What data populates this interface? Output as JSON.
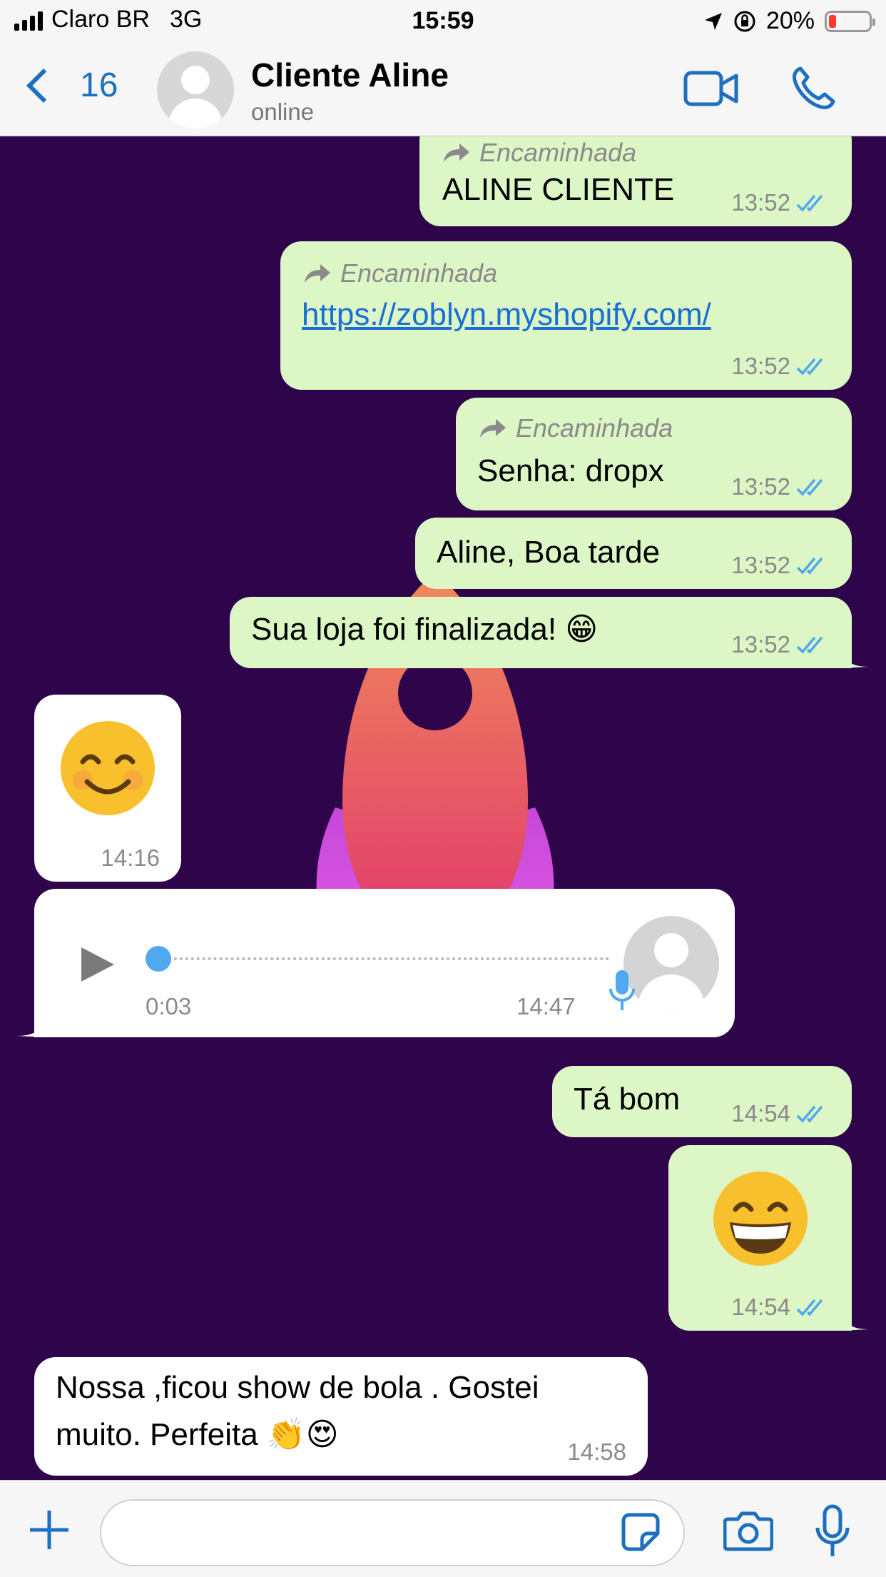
{
  "status_bar": {
    "carrier": "Claro BR",
    "network": "3G",
    "time": "15:59",
    "battery": "20%",
    "icons": [
      "signal-icon",
      "location-icon",
      "rotation-lock-icon",
      "battery-icon"
    ]
  },
  "header": {
    "back_count": "16",
    "contact_name": "Cliente Aline",
    "contact_status": "online",
    "icons": [
      "back-chevron-icon",
      "avatar-icon",
      "video-call-icon",
      "phone-icon"
    ]
  },
  "messages": [
    {
      "direction": "out",
      "forwarded_label": "Encaminhada",
      "text": "ALINE CLIENTE",
      "time": "13:52",
      "read": true
    },
    {
      "direction": "out",
      "forwarded_label": "Encaminhada",
      "text": "https://zoblyn.myshopify.com/",
      "time": "13:52",
      "read": true
    },
    {
      "direction": "out",
      "forwarded_label": "Encaminhada",
      "text": "Senha: dropx",
      "time": "13:52",
      "read": true
    },
    {
      "direction": "out",
      "text": "Aline, Boa tarde",
      "time": "13:52",
      "read": true
    },
    {
      "direction": "out",
      "text": "Sua loja foi finalizada! 😁",
      "time": "13:52",
      "read": true
    },
    {
      "direction": "in",
      "emoji": "😊",
      "time": "14:16"
    },
    {
      "direction": "in",
      "type": "voice",
      "duration": "0:03",
      "time": "14:47",
      "progress": 0.0
    },
    {
      "direction": "out",
      "text": "Tá bom",
      "time": "14:54",
      "read": true
    },
    {
      "direction": "out",
      "emoji": "😁",
      "time": "14:54",
      "read": true
    },
    {
      "direction": "in",
      "text_line1": "Nossa ,ficou show de bola . Gostei",
      "text_line2": "muito. Perfeita 👏😍",
      "time": "14:58"
    }
  ],
  "input_bar": {
    "value": "",
    "icons": [
      "plus-icon",
      "sticker-icon",
      "camera-icon",
      "microphone-icon"
    ]
  },
  "colors": {
    "chat_background": "#2e044a",
    "outgoing_bubble": "#dcf7c5",
    "incoming_bubble": "#ffffff",
    "accent": "#1d6fbf",
    "read_check": "#4fa8f0"
  }
}
